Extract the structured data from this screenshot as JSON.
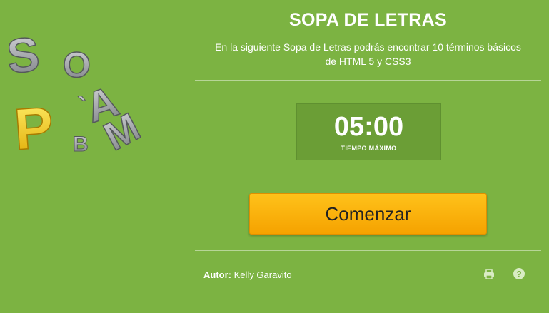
{
  "logo": {
    "letters": [
      "S",
      "O",
      "P",
      "A",
      "M",
      "B",
      "`"
    ]
  },
  "title": "SOPA DE LETRAS",
  "description": {
    "line1": "En la siguiente Sopa de Letras podrás encontrar 10 términos básicos",
    "line2": "de HTML 5 y CSS3"
  },
  "timer": {
    "value": "05:00",
    "label": "TIEMPO MÁXIMO"
  },
  "start_button": "Comenzar",
  "author": {
    "label": "Autor",
    "separator": ":",
    "name": "Kelly Garavito"
  },
  "icons": [
    "print-icon",
    "help-icon"
  ],
  "colors": {
    "background": "#7cb342",
    "timer_bg": "#6b9e36",
    "button": "#ffb300"
  }
}
